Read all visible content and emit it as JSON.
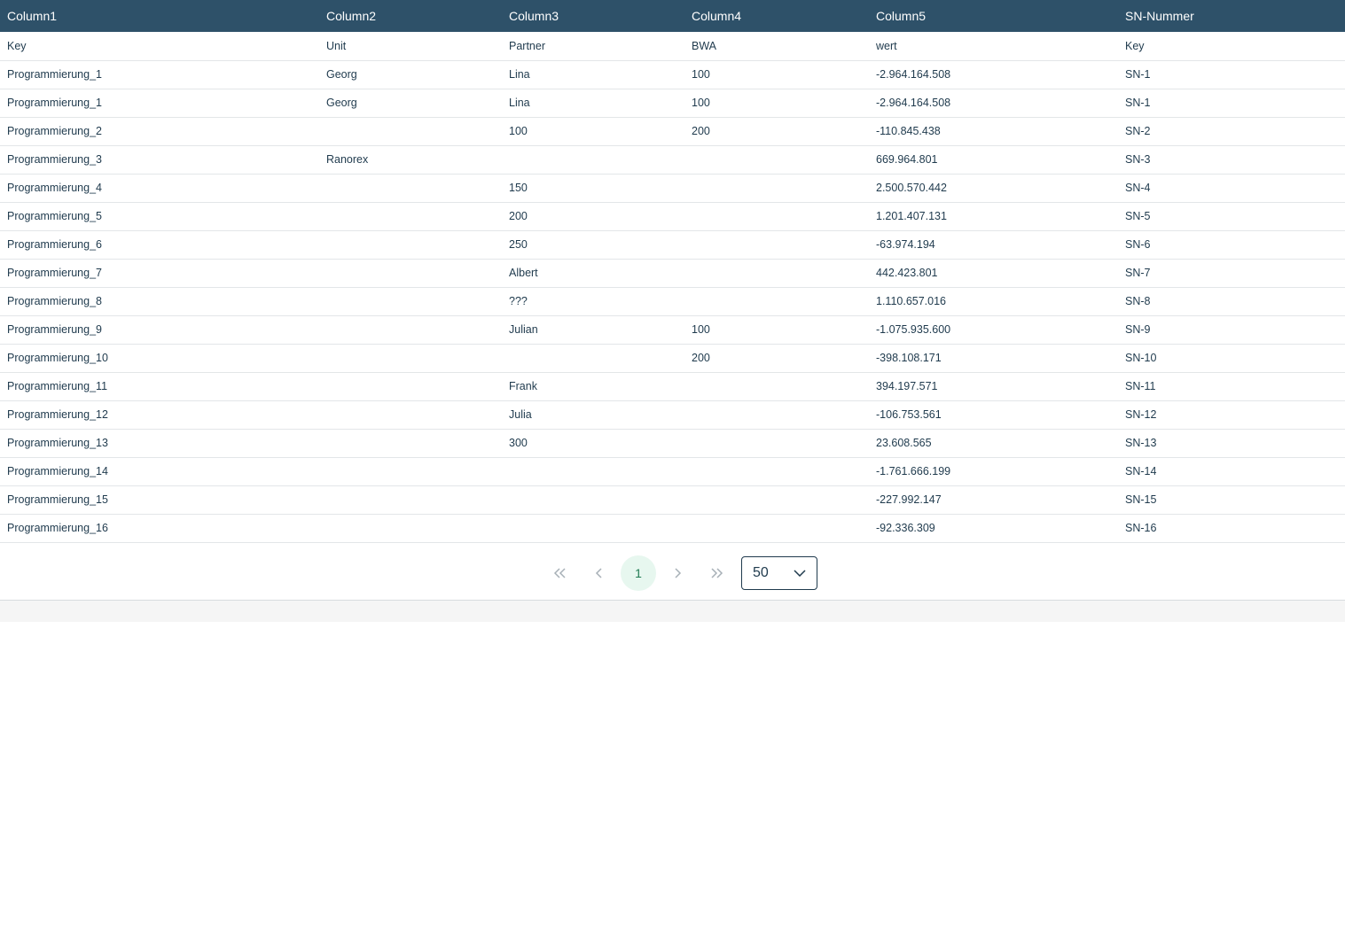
{
  "table": {
    "headers": [
      "Column1",
      "Column2",
      "Column3",
      "Column4",
      "Column5",
      "SN-Nummer"
    ],
    "rows": [
      [
        "Key",
        "Unit",
        "Partner",
        "BWA",
        "wert",
        "Key"
      ],
      [
        "Programmierung_1",
        "Georg",
        "Lina",
        "100",
        "-2.964.164.508",
        "SN-1"
      ],
      [
        "Programmierung_1",
        "Georg",
        "Lina",
        "100",
        "-2.964.164.508",
        "SN-1"
      ],
      [
        "Programmierung_2",
        "",
        "100",
        "200",
        "-110.845.438",
        "SN-2"
      ],
      [
        "Programmierung_3",
        "Ranorex",
        "",
        "",
        "669.964.801",
        "SN-3"
      ],
      [
        "Programmierung_4",
        "",
        "150",
        "",
        "2.500.570.442",
        "SN-4"
      ],
      [
        "Programmierung_5",
        "",
        "200",
        "",
        "1.201.407.131",
        "SN-5"
      ],
      [
        "Programmierung_6",
        "",
        "250",
        "",
        "-63.974.194",
        "SN-6"
      ],
      [
        "Programmierung_7",
        "",
        "Albert",
        "",
        "442.423.801",
        "SN-7"
      ],
      [
        "Programmierung_8",
        "",
        "???",
        "",
        "1.110.657.016",
        "SN-8"
      ],
      [
        "Programmierung_9",
        "",
        "Julian",
        "100",
        "-1.075.935.600",
        "SN-9"
      ],
      [
        "Programmierung_10",
        "",
        "",
        "200",
        "-398.108.171",
        "SN-10"
      ],
      [
        "Programmierung_11",
        "",
        "Frank",
        "",
        "394.197.571",
        "SN-11"
      ],
      [
        "Programmierung_12",
        "",
        "Julia",
        "",
        "-106.753.561",
        "SN-12"
      ],
      [
        "Programmierung_13",
        "",
        "300",
        "",
        "23.608.565",
        "SN-13"
      ],
      [
        "Programmierung_14",
        "",
        "",
        "",
        "-1.761.666.199",
        "SN-14"
      ],
      [
        "Programmierung_15",
        "",
        "",
        "",
        "-227.992.147",
        "SN-15"
      ],
      [
        "Programmierung_16",
        "",
        "",
        "",
        "-92.336.309",
        "SN-16"
      ]
    ]
  },
  "pagination": {
    "first_icon": "double-chevron-left-icon",
    "prev_icon": "chevron-left-icon",
    "current_page": "1",
    "next_icon": "chevron-right-icon",
    "last_icon": "double-chevron-right-icon",
    "page_size": "50",
    "page_size_icon": "chevron-down-icon"
  },
  "colors": {
    "header_bg": "#2e5169",
    "header_text": "#ffffff",
    "body_text": "#1f3a4d",
    "active_page_bg": "#e7f7ef",
    "active_page_text": "#1f7a52",
    "footer_strip": "#f5f5f5"
  }
}
